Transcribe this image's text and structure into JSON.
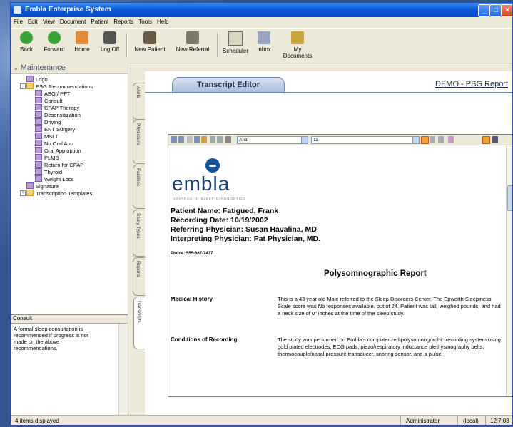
{
  "window": {
    "title": "Embla Enterprise System"
  },
  "menu": [
    "File",
    "Edit",
    "View",
    "Document",
    "Patient",
    "Reports",
    "Tools",
    "Help"
  ],
  "toolbar": {
    "back": "Back",
    "forward": "Forward",
    "home": "Home",
    "logoff": "Log Off",
    "new_patient": "New Patient",
    "new_referral": "New Referral",
    "scheduler": "Scheduler",
    "inbox": "Inbox",
    "my_documents": "My Documents"
  },
  "sidebar": {
    "header": "Maintenance",
    "items": [
      {
        "label": "Logo",
        "level": 1,
        "type": "doc"
      },
      {
        "label": "PSG Recommendations",
        "level": 1,
        "type": "folder",
        "expanded": true
      },
      {
        "label": "ABG / PFT",
        "level": 2,
        "type": "doc"
      },
      {
        "label": "Consult",
        "level": 2,
        "type": "doc"
      },
      {
        "label": "CPAP Therapy",
        "level": 2,
        "type": "doc"
      },
      {
        "label": "Desensitization",
        "level": 2,
        "type": "doc"
      },
      {
        "label": "Driving",
        "level": 2,
        "type": "doc"
      },
      {
        "label": "ENT Surgery",
        "level": 2,
        "type": "doc"
      },
      {
        "label": "MSLT",
        "level": 2,
        "type": "doc"
      },
      {
        "label": "No Oral App",
        "level": 2,
        "type": "doc"
      },
      {
        "label": "Oral App option",
        "level": 2,
        "type": "doc"
      },
      {
        "label": "PLMD",
        "level": 2,
        "type": "doc"
      },
      {
        "label": "Return for CPAP",
        "level": 2,
        "type": "doc"
      },
      {
        "label": "Thyroid",
        "level": 2,
        "type": "doc"
      },
      {
        "label": "Weight Loss",
        "level": 2,
        "type": "doc"
      },
      {
        "label": "Signature",
        "level": 1,
        "type": "doc"
      },
      {
        "label": "Transcription Templates",
        "level": 1,
        "type": "folder",
        "expanded": false
      }
    ]
  },
  "consult_panel": {
    "title": "Consult",
    "text": "A formal sleep consultation is recommended if progress is not made on the above recommendations."
  },
  "vertical_tabs": [
    "Alerts",
    "Physicians",
    "Facilities",
    "Study Types",
    "Reports",
    "Transcripts"
  ],
  "editor": {
    "tab_label": "Transcript Editor",
    "doc_title": "DEMO - PSG Report",
    "font": "Arial",
    "font_size": "11",
    "logo_text": "embla",
    "logo_tagline": "ADVANCE IN SLEEP DIAGNOSTICS",
    "patient_name": "Patient Name:  Fatigued, Frank",
    "recording_date": "Recording Date: 10/19/2002",
    "referring": "Referring Physician: Susan Havalina, MD",
    "interpreting": "Interpreting Physician: Pat Physician,  MD.",
    "phone": "Phone: 555-667-7437",
    "report_title": "Polysomnographic Report",
    "sections": [
      {
        "label": "Medical History",
        "text": "This is a 43 year old Male referred to the Sleep Disorders Center. The Epworth Sleepiness Scale score was No responses available. out of 24.  Patient was  tall, weighed  pounds, and had a neck size of 0\" inches at the time of the sleep study."
      },
      {
        "label": "Conditions of Recording",
        "text": "The study was performed on Embla's computerized polysomnographic recording system using gold plated electrodes, ECG pads, piezo/respiratory inductance plethysmography belts, thermocouple/nasal pressure transducer, snoring sensor, and a pulse"
      }
    ]
  },
  "status": {
    "left": "4 items displayed",
    "user": "Administrator",
    "server": "(local)",
    "time": "12:7:08"
  },
  "colors": {
    "titlebar": "#0a5ad8",
    "accent": "#1d3f73"
  }
}
